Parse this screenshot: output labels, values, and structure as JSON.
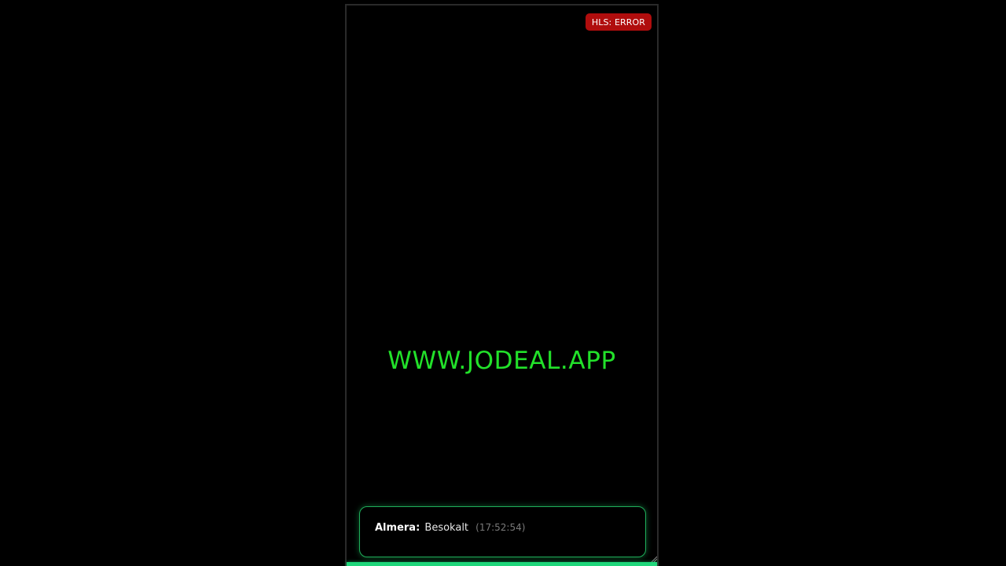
{
  "player": {
    "status_badge": "HLS: ERROR",
    "status_color": "#b00d0d",
    "watermark": "WWW.JODEAL.APP",
    "watermark_color": "#22e12a",
    "progress_fraction": 1.0,
    "progress_color": "#1fd67a"
  },
  "chat": {
    "messages": [
      {
        "user": "Almera:",
        "text": "Besokalt",
        "time": "(17:52:54)"
      }
    ]
  },
  "icons": {
    "resize": "resize-grip-icon"
  }
}
